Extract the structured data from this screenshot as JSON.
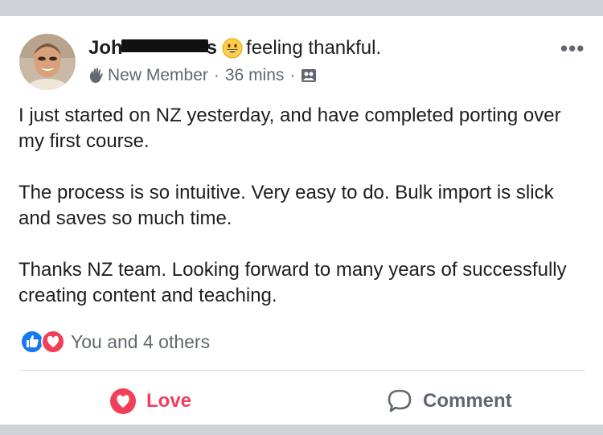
{
  "post": {
    "author_prefix": "Joh",
    "author_suffix": "s",
    "feeling_text": "feeling thankful.",
    "badge": "New Member",
    "time": "36 mins",
    "body": [
      "I just started on NZ yesterday, and have completed porting over my first course.",
      "The process is so intuitive. Very easy to do. Bulk import is slick and saves so much time.",
      "Thanks NZ team. Looking forward to many years of successfully creating content and teaching."
    ],
    "reactions_text": "You and 4 others"
  },
  "actions": {
    "love_label": "Love",
    "comment_label": "Comment"
  },
  "colors": {
    "love": "#f33e58",
    "like": "#1877f2",
    "secondary_text": "#606770"
  },
  "icons": [
    "waving-hand-icon",
    "grinning-emoji-icon",
    "group-icon",
    "more-options-icon",
    "like-reaction-icon",
    "love-reaction-icon",
    "heart-icon",
    "comment-bubble-icon"
  ]
}
